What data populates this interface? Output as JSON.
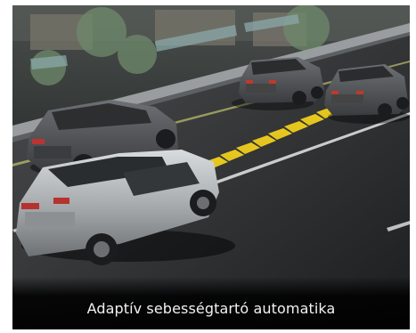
{
  "image": {
    "alt_subject": "two-car adaptive cruise scene",
    "colors": {
      "road": "#3a3c3e",
      "lane_marking": "#e9ea7a",
      "radar_beam": "#f4d21c",
      "car_silver": "#b7bbbe",
      "car_dark": "#55585c",
      "caption_bg": "#0b0b0b",
      "caption_text": "#f2f2f2"
    }
  },
  "caption": {
    "text": "Adaptív sebességtartó automatika"
  }
}
